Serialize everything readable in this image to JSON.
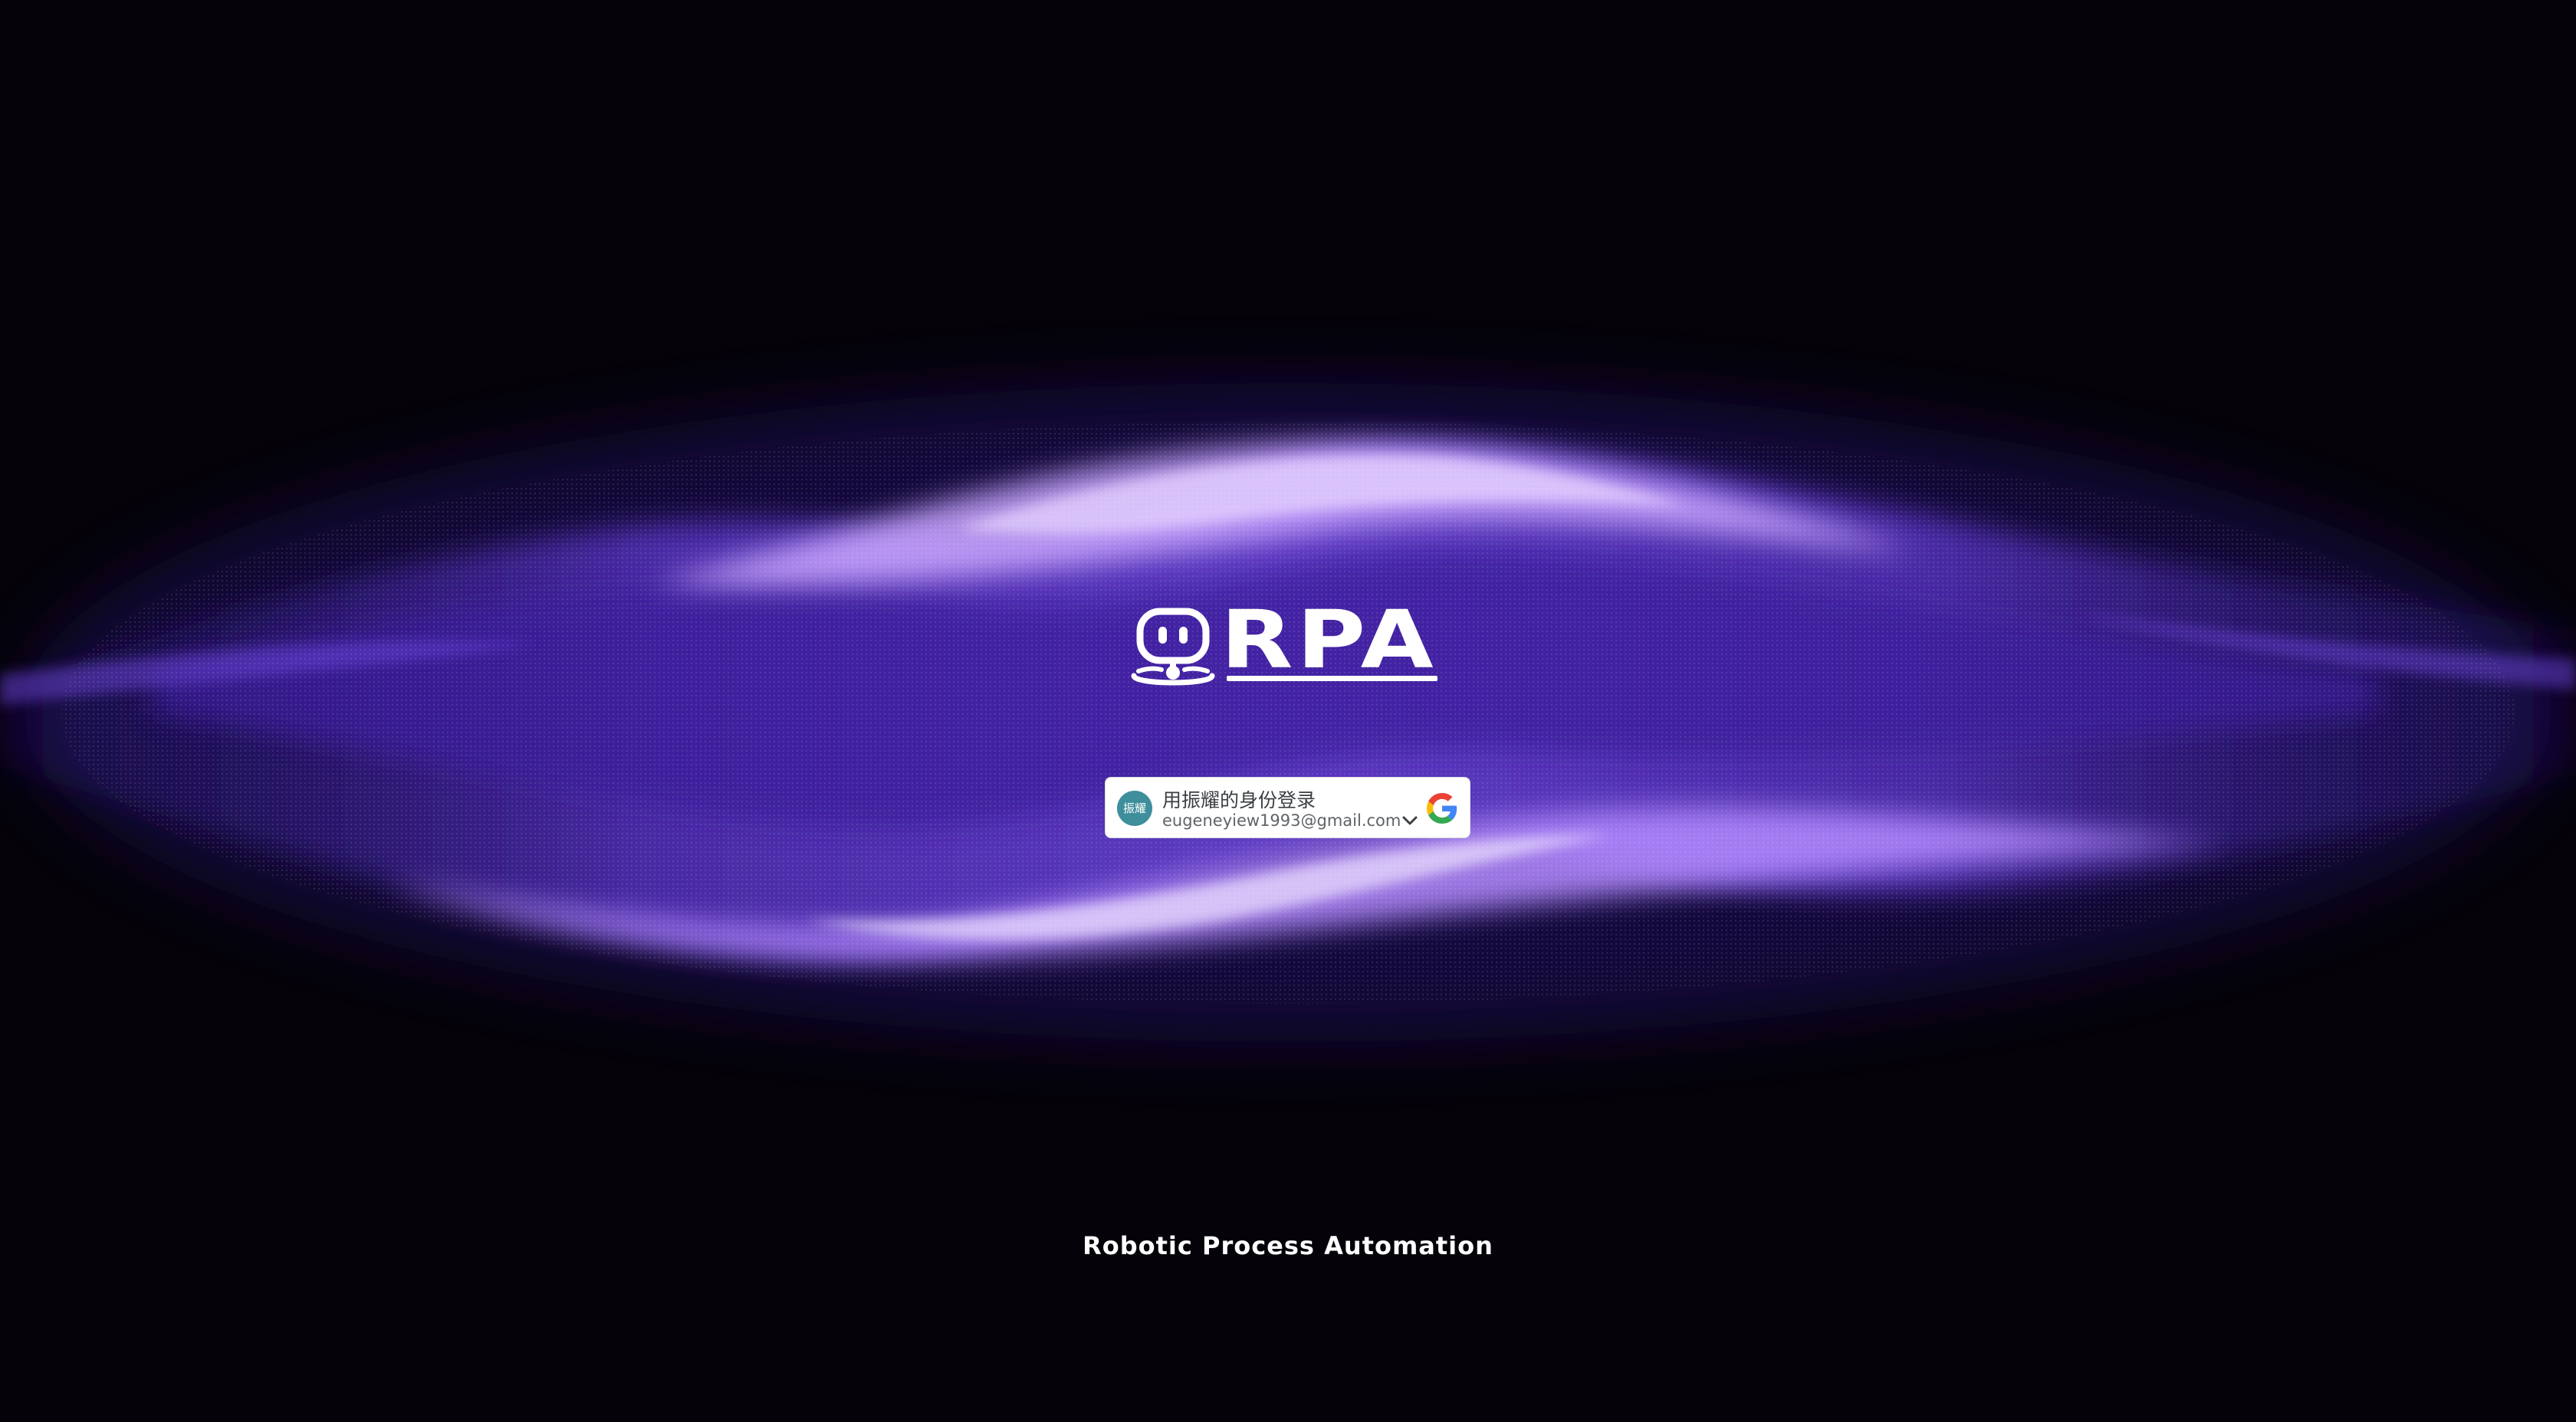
{
  "logo": {
    "text": "RPA",
    "icon": "robot-icon"
  },
  "signin": {
    "avatar_text": "振耀",
    "title": "用振耀的身份登录",
    "email": "eugeneyiew1993@gmail.com",
    "chevron_icon": "chevron-down-icon",
    "provider_icon": "google-icon"
  },
  "tagline": "Robotic Process Automation",
  "colors": {
    "background": "#050309",
    "wave_purple": "#7b4fe0",
    "wave_highlight": "#d6b8ff",
    "avatar": "#3e8e9c"
  }
}
